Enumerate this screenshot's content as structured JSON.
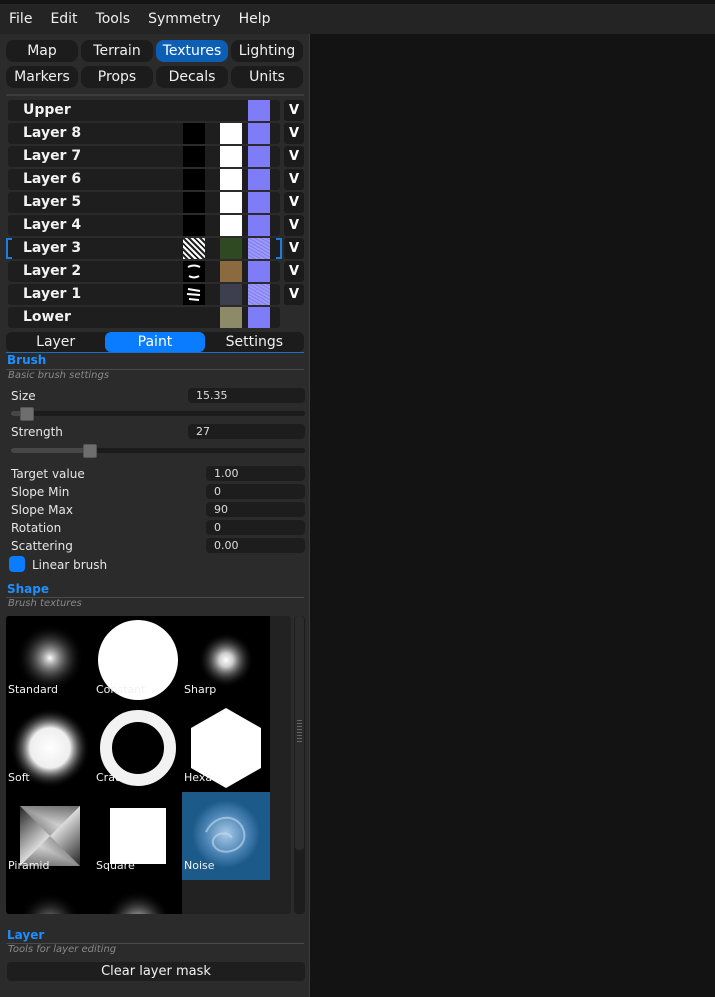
{
  "menu": [
    "File",
    "Edit",
    "Tools",
    "Symmetry",
    "Help"
  ],
  "tabs": [
    {
      "label": "Map",
      "active": false
    },
    {
      "label": "Terrain",
      "active": false
    },
    {
      "label": "Textures",
      "active": true
    },
    {
      "label": "Lighting",
      "active": false
    },
    {
      "label": "Markers",
      "active": false
    },
    {
      "label": "Props",
      "active": false
    },
    {
      "label": "Decals",
      "active": false
    },
    {
      "label": "Units",
      "active": false
    }
  ],
  "layers": [
    {
      "name": "Upper",
      "mask": "none",
      "diffuse": "none",
      "normal": "normal",
      "visible_toggle": "V"
    },
    {
      "name": "Layer 8",
      "mask": "black",
      "diffuse": "white",
      "normal": "normal",
      "visible_toggle": "V"
    },
    {
      "name": "Layer 7",
      "mask": "black",
      "diffuse": "white",
      "normal": "normal",
      "visible_toggle": "V"
    },
    {
      "name": "Layer 6",
      "mask": "black",
      "diffuse": "white",
      "normal": "normal",
      "visible_toggle": "V"
    },
    {
      "name": "Layer 5",
      "mask": "black",
      "diffuse": "white",
      "normal": "normal",
      "visible_toggle": "V"
    },
    {
      "name": "Layer 4",
      "mask": "black",
      "diffuse": "white",
      "normal": "normal",
      "visible_toggle": "V"
    },
    {
      "name": "Layer 3",
      "mask": "noise",
      "diffuse": "grass",
      "normal": "normal-noisy",
      "visible_toggle": "V",
      "selected": true
    },
    {
      "name": "Layer 2",
      "mask": "dark-shape",
      "diffuse": "dirt",
      "normal": "normal",
      "visible_toggle": "V"
    },
    {
      "name": "Layer 1",
      "mask": "dark-streaks",
      "diffuse": "rock",
      "normal": "normal-noisy",
      "visible_toggle": "V"
    },
    {
      "name": "Lower",
      "mask": "none",
      "diffuse": "gravel",
      "normal": "normal",
      "visible_toggle": ""
    }
  ],
  "subtabs": [
    {
      "label": "Layer",
      "active": false
    },
    {
      "label": "Paint",
      "active": true
    },
    {
      "label": "Settings",
      "active": false
    }
  ],
  "brush": {
    "title": "Brush",
    "subtitle": "Basic brush settings",
    "size_label": "Size",
    "size_value": "15.35",
    "size_fraction": 0.055,
    "strength_label": "Strength",
    "strength_value": "27",
    "strength_fraction": 0.27,
    "target_label": "Target value",
    "target_value": "1.00",
    "slope_min_label": "Slope Min",
    "slope_min_value": "0",
    "slope_max_label": "Slope Max",
    "slope_max_value": "90",
    "rotation_label": "Rotation",
    "rotation_value": "0",
    "scattering_label": "Scattering",
    "scattering_value": "0.00",
    "linear_label": "Linear brush",
    "linear_checked": true
  },
  "shape": {
    "title": "Shape",
    "subtitle": "Brush textures",
    "items": [
      {
        "name": "Standard",
        "kind": "soft-small"
      },
      {
        "name": "Constant",
        "kind": "hard-circle"
      },
      {
        "name": "Sharp",
        "kind": "sharp-dot"
      },
      {
        "name": "Soft",
        "kind": "soft-large"
      },
      {
        "name": "Crater",
        "kind": "ring"
      },
      {
        "name": "Hexa",
        "kind": "hexagon"
      },
      {
        "name": "Piramid",
        "kind": "pyramid"
      },
      {
        "name": "Square",
        "kind": "square"
      },
      {
        "name": "Noise",
        "kind": "noise",
        "selected": true
      }
    ]
  },
  "layer_tools": {
    "title": "Layer",
    "subtitle": "Tools for layer editing",
    "clear_mask": "Clear layer mask"
  }
}
